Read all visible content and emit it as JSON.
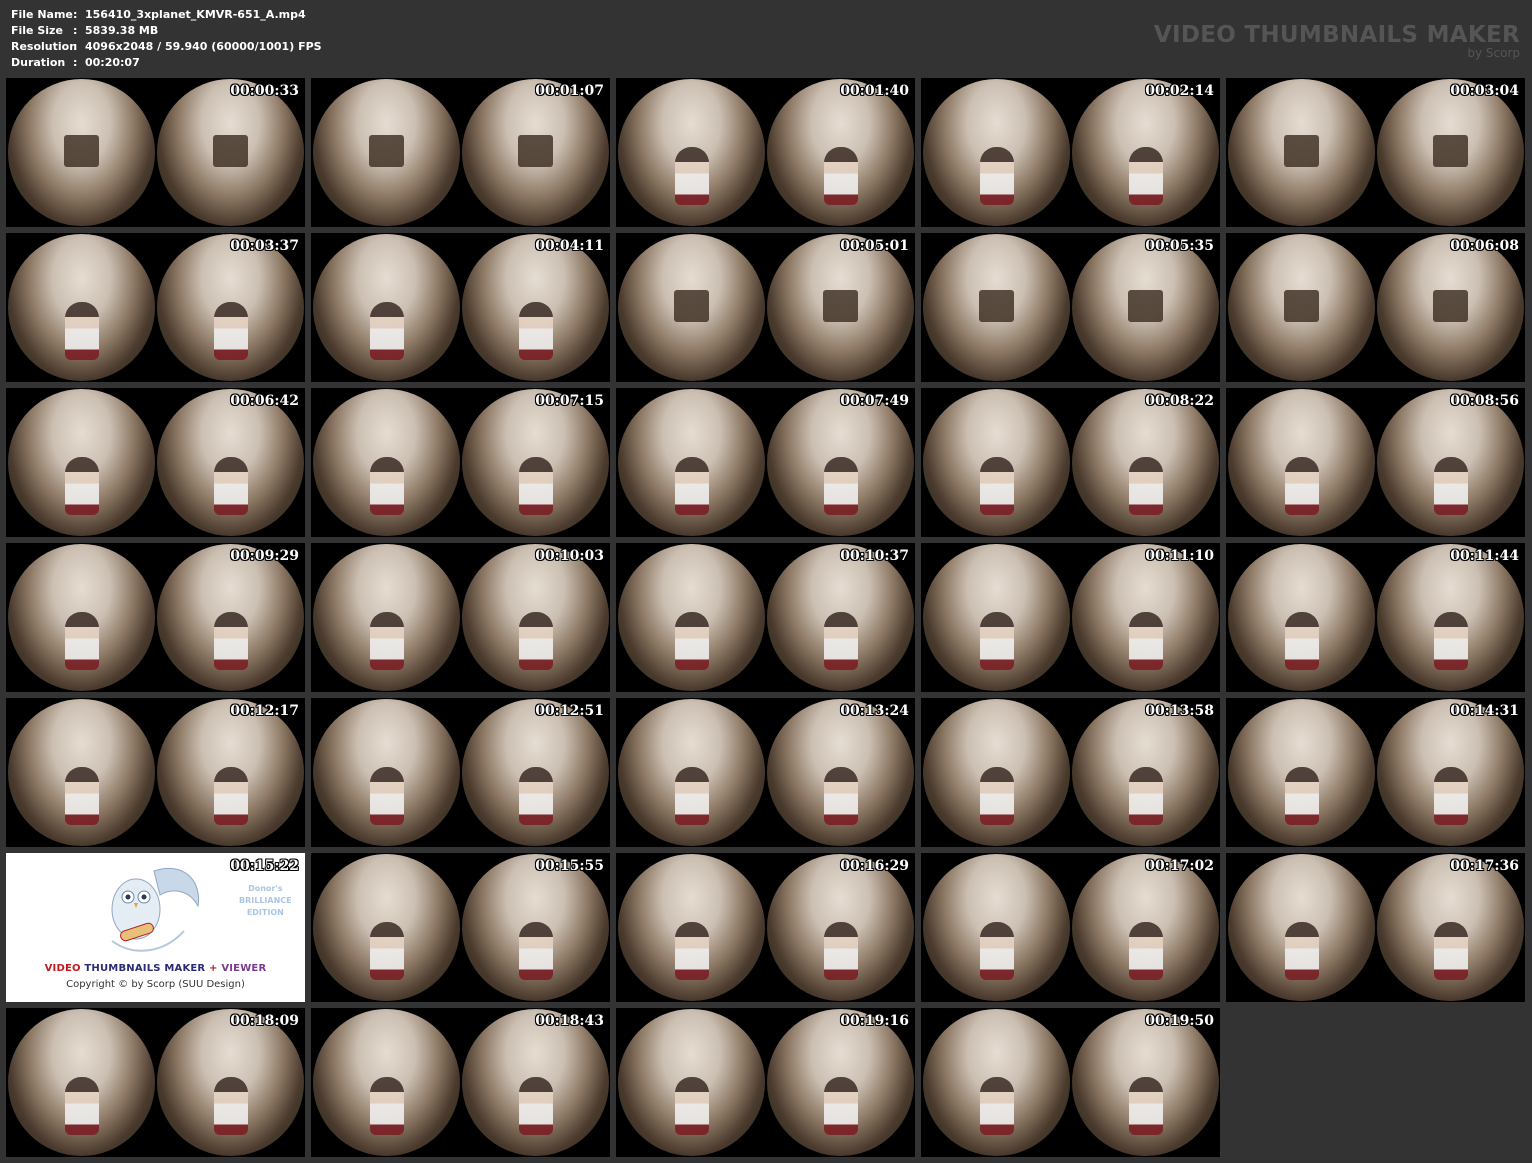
{
  "header": {
    "info": [
      {
        "label": "File Name",
        "sep": ":",
        "value": "156410_3xplanet_KMVR-651_A.mp4"
      },
      {
        "label": "File Size",
        "sep": ":",
        "value": "5839.38 MB"
      },
      {
        "label": "Resolution",
        "sep": ":",
        "value": "4096x2048 / 59.940 (60000/1001) FPS"
      },
      {
        "label": "Duration",
        "sep": ":",
        "value": "00:20:07"
      }
    ],
    "brand_title": "VIDEO THUMBNAILS MAKER",
    "brand_sub": "by Scorp"
  },
  "thumbnails": [
    {
      "time": "00:00:33",
      "scene": "room"
    },
    {
      "time": "00:01:07",
      "scene": "room"
    },
    {
      "time": "00:01:40",
      "scene": "girl"
    },
    {
      "time": "00:02:14",
      "scene": "girl"
    },
    {
      "time": "00:03:04",
      "scene": "room"
    },
    {
      "time": "00:03:37",
      "scene": "girl"
    },
    {
      "time": "00:04:11",
      "scene": "girl"
    },
    {
      "time": "00:05:01",
      "scene": "room"
    },
    {
      "time": "00:05:35",
      "scene": "room"
    },
    {
      "time": "00:06:08",
      "scene": "room"
    },
    {
      "time": "00:06:42",
      "scene": "girl"
    },
    {
      "time": "00:07:15",
      "scene": "girl"
    },
    {
      "time": "00:07:49",
      "scene": "girl"
    },
    {
      "time": "00:08:22",
      "scene": "girl"
    },
    {
      "time": "00:08:56",
      "scene": "girl"
    },
    {
      "time": "00:09:29",
      "scene": "girl"
    },
    {
      "time": "00:10:03",
      "scene": "girl"
    },
    {
      "time": "00:10:37",
      "scene": "girl"
    },
    {
      "time": "00:11:10",
      "scene": "girl"
    },
    {
      "time": "00:11:44",
      "scene": "girl"
    },
    {
      "time": "00:12:17",
      "scene": "girl"
    },
    {
      "time": "00:12:51",
      "scene": "girl"
    },
    {
      "time": "00:13:24",
      "scene": "girl"
    },
    {
      "time": "00:13:58",
      "scene": "girl"
    },
    {
      "time": "00:14:31",
      "scene": "girl"
    },
    {
      "time": "00:15:22",
      "scene": "logo"
    },
    {
      "time": "00:15:55",
      "scene": "girl"
    },
    {
      "time": "00:16:29",
      "scene": "girl"
    },
    {
      "time": "00:17:02",
      "scene": "girl"
    },
    {
      "time": "00:17:36",
      "scene": "girl"
    },
    {
      "time": "00:18:09",
      "scene": "girl"
    },
    {
      "time": "00:18:43",
      "scene": "girl"
    },
    {
      "time": "00:19:16",
      "scene": "girl"
    },
    {
      "time": "00:19:50",
      "scene": "girl"
    }
  ],
  "logo_card": {
    "edition_line1": "Donor's",
    "edition_line2": "BRILLIANCE",
    "edition_line3": "EDITION",
    "title_a": "VIDEO",
    "title_b": "THUMBNAILS MAKER",
    "title_c": "+",
    "title_d": "VIEWER",
    "copyright": "Copyright © by Scorp (SUU Design)"
  },
  "colors": {
    "background": "#333333",
    "brand": "#555555",
    "thumb_bg": "#000000"
  }
}
